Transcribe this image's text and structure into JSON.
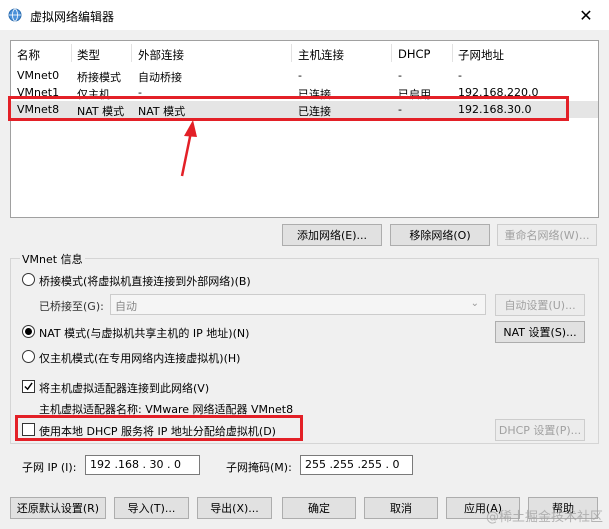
{
  "window": {
    "title": "虚拟网络编辑器",
    "close_glyph": "✕"
  },
  "table": {
    "headers": [
      "名称",
      "类型",
      "外部连接",
      "主机连接",
      "DHCP",
      "子网地址"
    ],
    "rows": [
      {
        "name": "VMnet0",
        "type": "桥接模式",
        "external": "自动桥接",
        "host": "-",
        "dhcp": "-",
        "subnet": "-"
      },
      {
        "name": "VMnet1",
        "type": "仅主机...",
        "external": "-",
        "host": "已连接",
        "dhcp": "已启用",
        "subnet": "192.168.220.0"
      },
      {
        "name": "VMnet8",
        "type": "NAT 模式",
        "external": "NAT 模式",
        "host": "已连接",
        "dhcp": "-",
        "subnet": "192.168.30.0"
      }
    ]
  },
  "list_buttons": {
    "add": "添加网络(E)...",
    "remove": "移除网络(O)",
    "rename": "重命名网络(W)..."
  },
  "vmnet_info": {
    "legend": "VMnet 信息",
    "bridged_label": "桥接模式(将虚拟机直接连接到外部网络)(B)",
    "bridged_to_label": "已桥接至(G):",
    "bridged_to_value": "自动",
    "auto_settings": "自动设置(U)...",
    "nat_label": "NAT 模式(与虚拟机共享主机的 IP 地址)(N)",
    "nat_settings": "NAT 设置(S)...",
    "host_only_label": "仅主机模式(在专用网络内连接虚拟机)(H)",
    "connect_adapter_label": "将主机虚拟适配器连接到此网络(V)",
    "adapter_name_label": "主机虚拟适配器名称: VMware 网络适配器 VMnet8",
    "dhcp_label": "使用本地 DHCP 服务将 IP 地址分配给虚拟机(D)",
    "dhcp_settings": "DHCP 设置(P)..."
  },
  "subnet": {
    "ip_label": "子网 IP (I):",
    "ip_value": "192 .168 . 30 . 0",
    "mask_label": "子网掩码(M):",
    "mask_value": "255 .255 .255 . 0"
  },
  "bottom_buttons": {
    "restore": "还原默认设置(R)",
    "import": "导入(T)...",
    "export": "导出(X)...",
    "ok": "确定",
    "cancel": "取消",
    "apply": "应用(A)",
    "help": "帮助"
  },
  "watermark": "@稀土掘金技术社区",
  "colors": {
    "annotation": "#e32027",
    "selected_row": "#e5e5e5"
  }
}
